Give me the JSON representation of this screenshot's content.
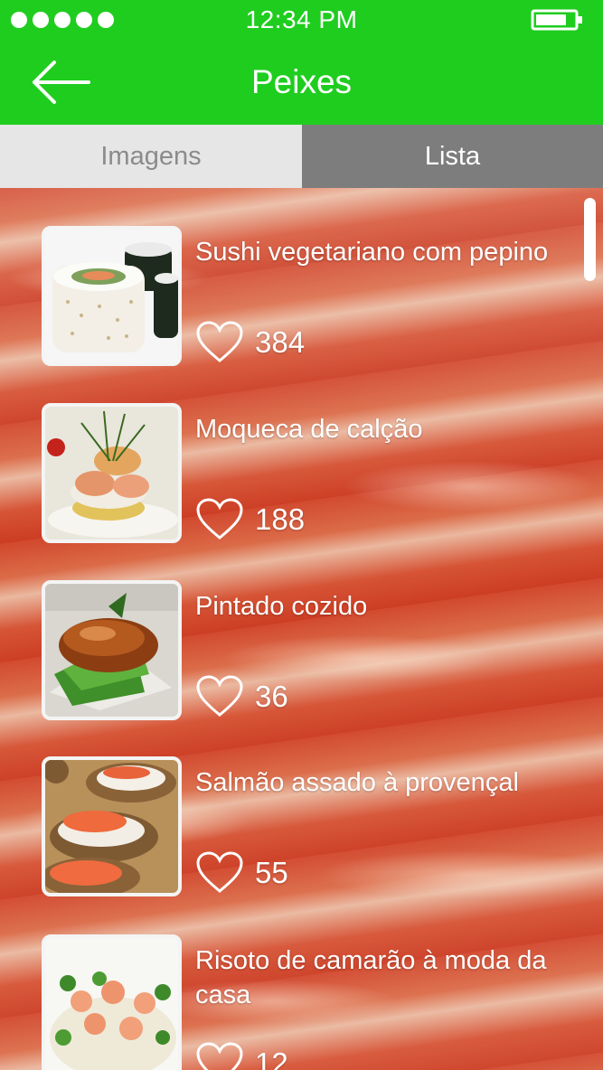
{
  "status_bar": {
    "time": "12:34 PM",
    "signal_icon": "signal-dots-icon",
    "battery_icon": "battery-icon"
  },
  "header": {
    "title": "Peixes",
    "back_icon": "arrow-left-icon",
    "color": "#1fcd1f"
  },
  "tabs": [
    {
      "label": "Imagens",
      "selected": false
    },
    {
      "label": "Lista",
      "selected": true
    }
  ],
  "items": [
    {
      "name": "Sushi vegetariano com pepino",
      "likes": "384",
      "thumb": "sushi"
    },
    {
      "name": "Moqueca de calção",
      "likes": "188",
      "thumb": "shrimp"
    },
    {
      "name": "Pintado cozido",
      "likes": "36",
      "thumb": "fish"
    },
    {
      "name": "Salmão assado à provençal",
      "likes": "55",
      "thumb": "salmon"
    },
    {
      "name": "Risoto de camarão à moda da casa",
      "likes": "12",
      "thumb": "risotto"
    }
  ]
}
